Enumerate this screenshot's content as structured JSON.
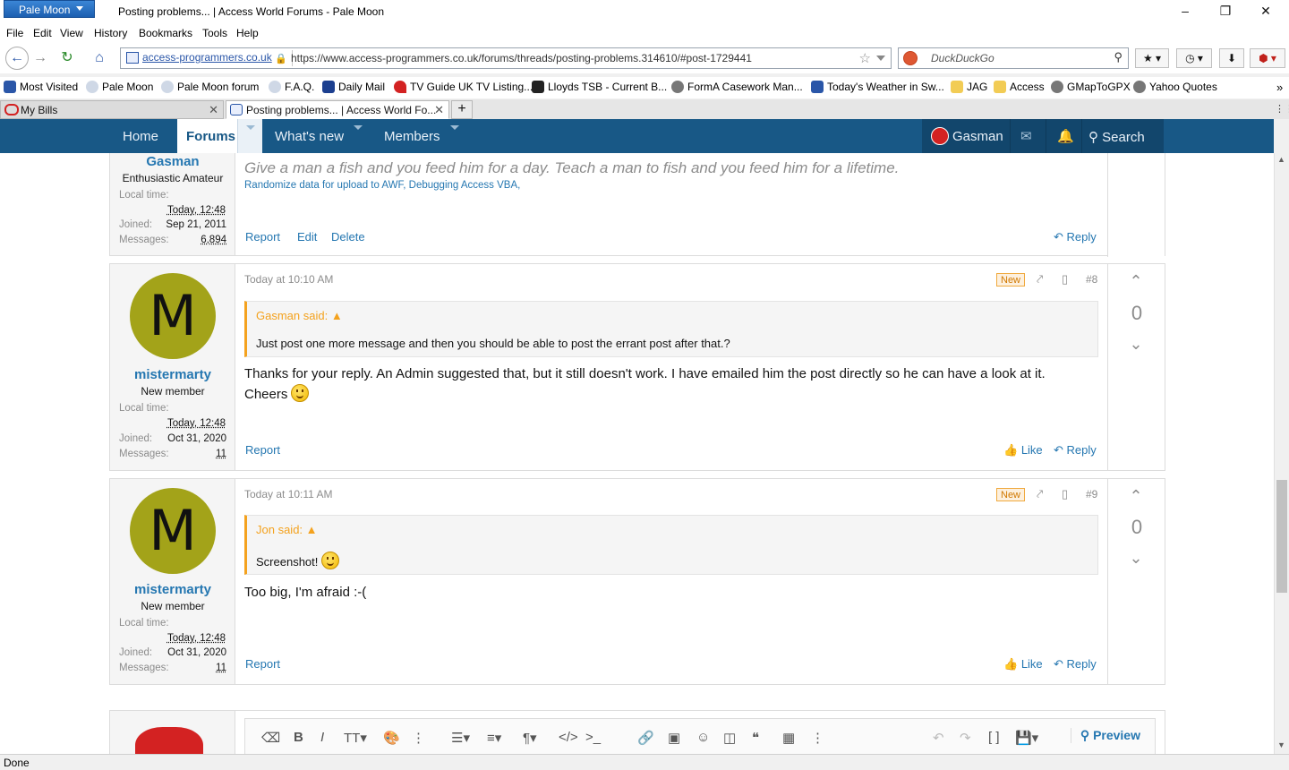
{
  "browser": {
    "app_button": "Pale Moon",
    "window_title": "Posting problems... | Access World Forums - Pale Moon",
    "menu": [
      "File",
      "Edit",
      "View",
      "History",
      "Bookmarks",
      "Tools",
      "Help"
    ],
    "site_identity": "access-programmers.co.uk",
    "url": "https://www.access-programmers.co.uk/forums/threads/posting-problems.314610/#post-1729441",
    "search_placeholder": "DuckDuckGo",
    "bookmarks": [
      "Most Visited",
      "Pale Moon",
      "Pale Moon forum",
      "F.A.Q.",
      "Daily Mail",
      "TV Guide UK TV Listing...",
      "Lloyds TSB - Current B...",
      "FormA Casework Man...",
      "Today's Weather in Sw...",
      "JAG",
      "Access",
      "GMapToGPX",
      "Yahoo Quotes"
    ],
    "tabs": [
      "My Bills",
      "Posting problems... | Access World Fo..."
    ],
    "status": "Done"
  },
  "forum_nav": {
    "home": "Home",
    "forums": "Forums",
    "whats_new": "What's new",
    "members": "Members",
    "user": "Gasman",
    "search": "Search"
  },
  "prev_post": {
    "user_name": "Gasman",
    "user_title": "Enthusiastic Amateur",
    "local_time_label": "Local time:",
    "local_time": "Today, 12:48",
    "joined_label": "Joined:",
    "joined": "Sep 21, 2011",
    "messages_label": "Messages:",
    "messages": "6,894",
    "signature": "Give a man a fish and you feed him for a day. Teach a man to fish and you feed him for a lifetime.",
    "sig_links": "Randomize data for upload to AWF, Debugging Access VBA,",
    "report": "Report",
    "edit": "Edit",
    "delete": "Delete",
    "reply": "Reply"
  },
  "posts": [
    {
      "avatar_letter": "M",
      "user_name": "mistermarty",
      "user_title": "New member",
      "local_time_label": "Local time:",
      "local_time": "Today, 12:48",
      "joined_label": "Joined:",
      "joined": "Oct 31, 2020",
      "messages_label": "Messages:",
      "messages": "11",
      "time": "Today at 10:10 AM",
      "badge": "New",
      "number": "#8",
      "quote_author": "Gasman said:",
      "quote_text": "Just post one more message and then you should be able to post the errant post after that.?",
      "body_line1": "Thanks for your reply. An Admin suggested that, but it still doesn't work. I have emailed him the post directly so he can have a look at it.",
      "body_line2": "Cheers",
      "votes": "0",
      "report": "Report",
      "like": "Like",
      "reply": "Reply"
    },
    {
      "avatar_letter": "M",
      "user_name": "mistermarty",
      "user_title": "New member",
      "local_time_label": "Local time:",
      "local_time": "Today, 12:48",
      "joined_label": "Joined:",
      "joined": "Oct 31, 2020",
      "messages_label": "Messages:",
      "messages": "11",
      "time": "Today at 10:11 AM",
      "badge": "New",
      "number": "#9",
      "quote_author": "Jon said:",
      "quote_text": "Screenshot!",
      "body_line1": "Too big, I'm afraid :-(",
      "votes": "0",
      "report": "Report",
      "like": "Like",
      "reply": "Reply"
    }
  ],
  "editor": {
    "preview": "Preview"
  },
  "colors": {
    "nav_bg": "#185886",
    "link": "#2577b1",
    "quote_accent": "#f4a21e",
    "avatar_bg": "#a3a319"
  }
}
